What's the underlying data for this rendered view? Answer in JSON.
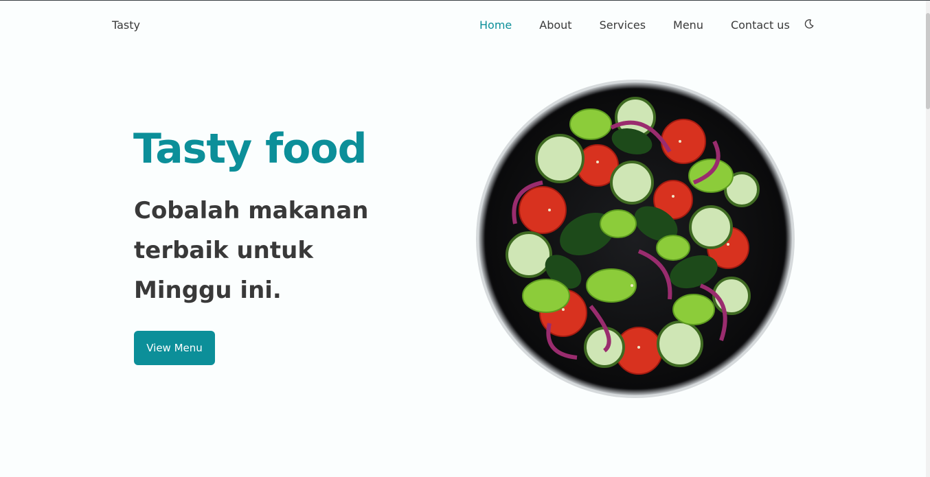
{
  "header": {
    "brand": "Tasty",
    "nav": [
      {
        "label": "Home",
        "active": true
      },
      {
        "label": "About",
        "active": false
      },
      {
        "label": "Services",
        "active": false
      },
      {
        "label": "Menu",
        "active": false
      },
      {
        "label": "Contact us",
        "active": false
      }
    ],
    "theme_toggle_icon": "moon-icon"
  },
  "hero": {
    "title": "Tasty food",
    "subtitle": "Cobalah makanan terbaik untuk Minggu ini.",
    "cta_label": "View Menu",
    "image": "salad-plate-image"
  },
  "colors": {
    "accent": "#0c8f99",
    "text": "#393939",
    "background": "#fbfefe"
  }
}
